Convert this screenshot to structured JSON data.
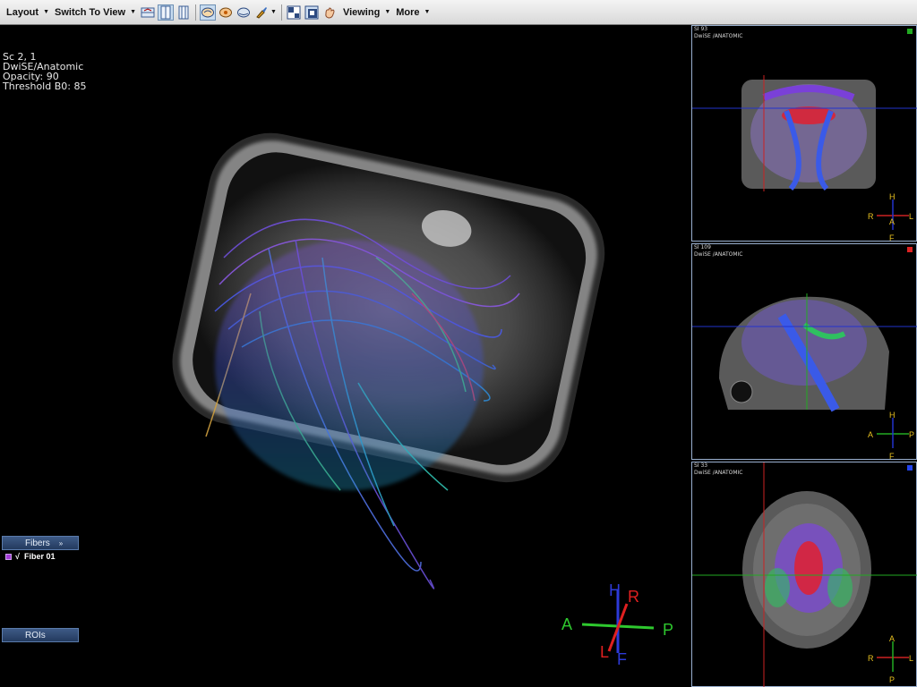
{
  "toolbar": {
    "layout": "Layout",
    "switch_to_view": "Switch To View",
    "viewing": "Viewing",
    "more": "More"
  },
  "overlay": {
    "line1": "Sc 2, 1",
    "line2": "DwiSE/Anatomic",
    "line3": "Opacity: 90",
    "line4": "Threshold B0: 85"
  },
  "fibers_panel": {
    "title": "Fibers",
    "item": "Fiber 01",
    "check": "√"
  },
  "rois_panel": {
    "title": "ROIs"
  },
  "orientation_main": {
    "h": "H",
    "r": "R",
    "a": "A",
    "p": "P",
    "l": "L",
    "f": "F"
  },
  "views": [
    {
      "slice": "SI 93",
      "series": "DwiSE  /ANATOMIC",
      "dot": "#22aa22",
      "axes": {
        "top": "H",
        "left": "R",
        "center": "A",
        "right": "L",
        "bottom": "F"
      }
    },
    {
      "slice": "SI 109",
      "series": "DwiSE  /ANATOMIC",
      "dot": "#dd2222",
      "axes": {
        "top": "H",
        "left": "A",
        "center": "",
        "right": "P",
        "bottom": "F"
      }
    },
    {
      "slice": "SI 33",
      "series": "DwiSE  /ANATOMIC",
      "dot": "#2244ee",
      "axes": {
        "top": "A",
        "left": "R",
        "center": "",
        "right": "L",
        "bottom": "P"
      }
    }
  ]
}
